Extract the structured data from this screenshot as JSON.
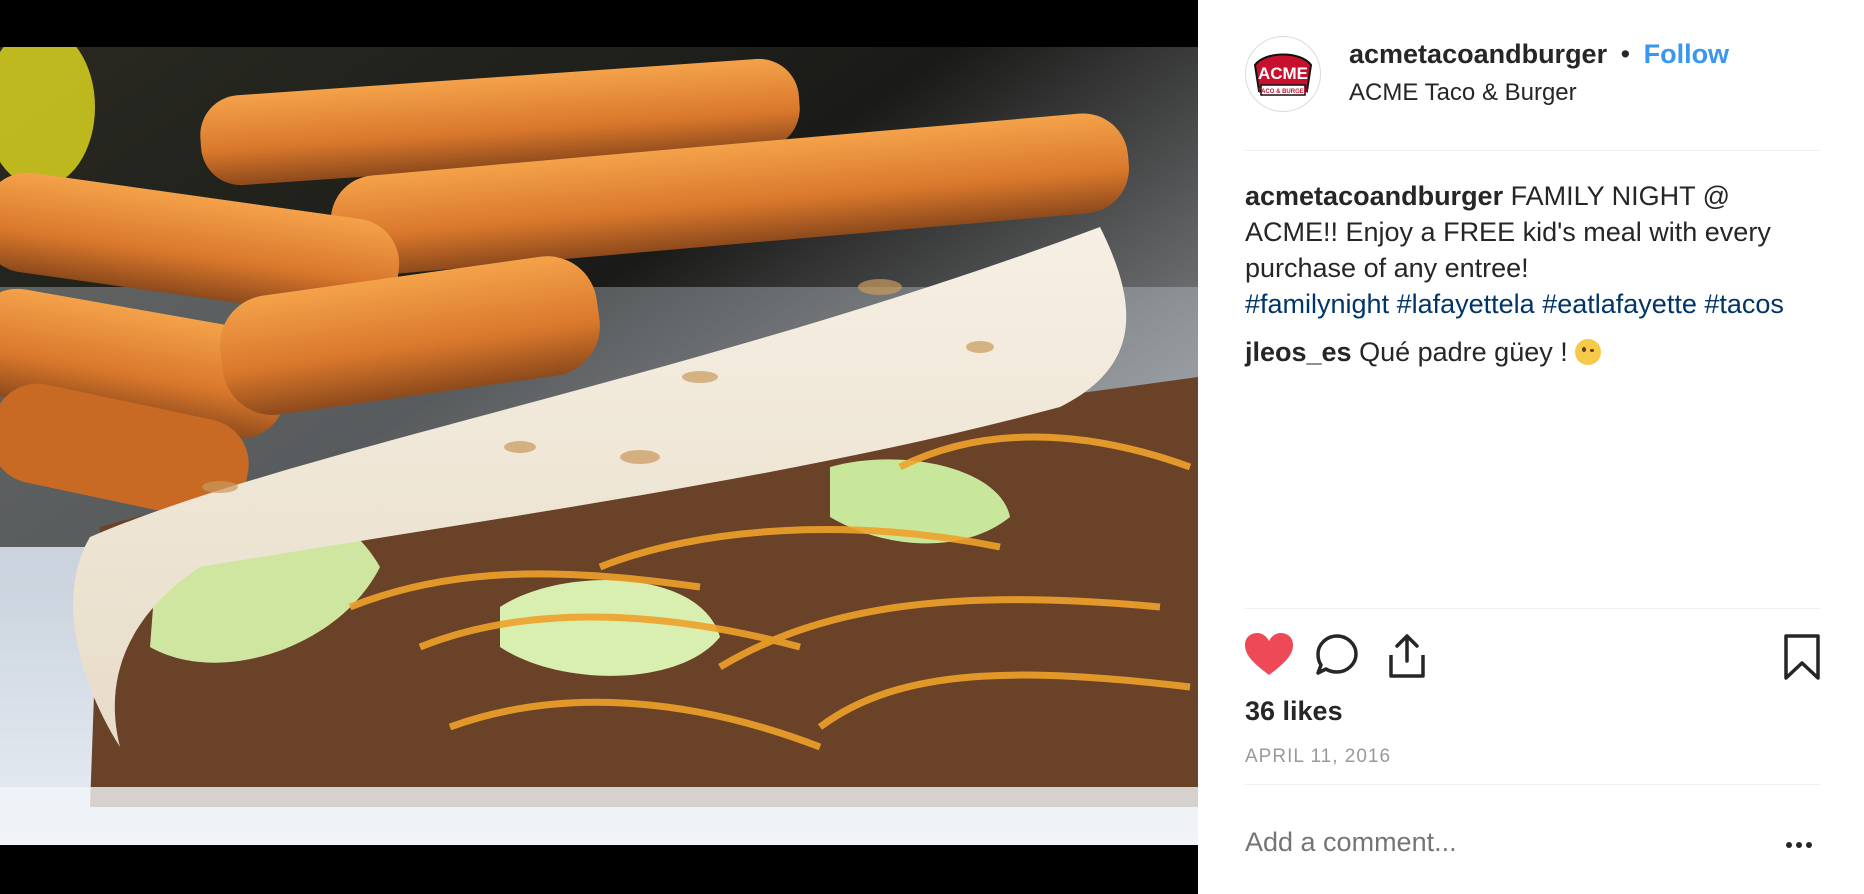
{
  "post": {
    "photo_alt": "Taco with fries",
    "author": {
      "username": "acmetacoandburger",
      "follow_label": "Follow",
      "separator": "•",
      "location": "ACME Taco & Burger",
      "logo_text_top": "ACME",
      "logo_text_bottom": "TACO & BURGER"
    },
    "caption": {
      "username": "acmetacoandburger",
      "text": "FAMILY NIGHT @ ACME!! Enjoy a FREE kid's meal with every purchase of any entree!",
      "hashtags": [
        "#familynight",
        "#lafayettela",
        "#eatlafayette",
        "#tacos"
      ]
    },
    "comments": [
      {
        "username": "jleos_es",
        "text": "Qué padre güey !",
        "emoji": "winking-face-with-tongue"
      }
    ],
    "likes": "36 likes",
    "date": "APRIL 11, 2016",
    "add_comment_placeholder": "Add a comment...",
    "colors": {
      "follow": "#3897f0",
      "hashtag": "#003569",
      "heart": "#ed4956",
      "muted": "#999999"
    },
    "icons": [
      "heart-icon",
      "comment-icon",
      "share-icon",
      "bookmark-icon",
      "more-options-icon"
    ]
  }
}
